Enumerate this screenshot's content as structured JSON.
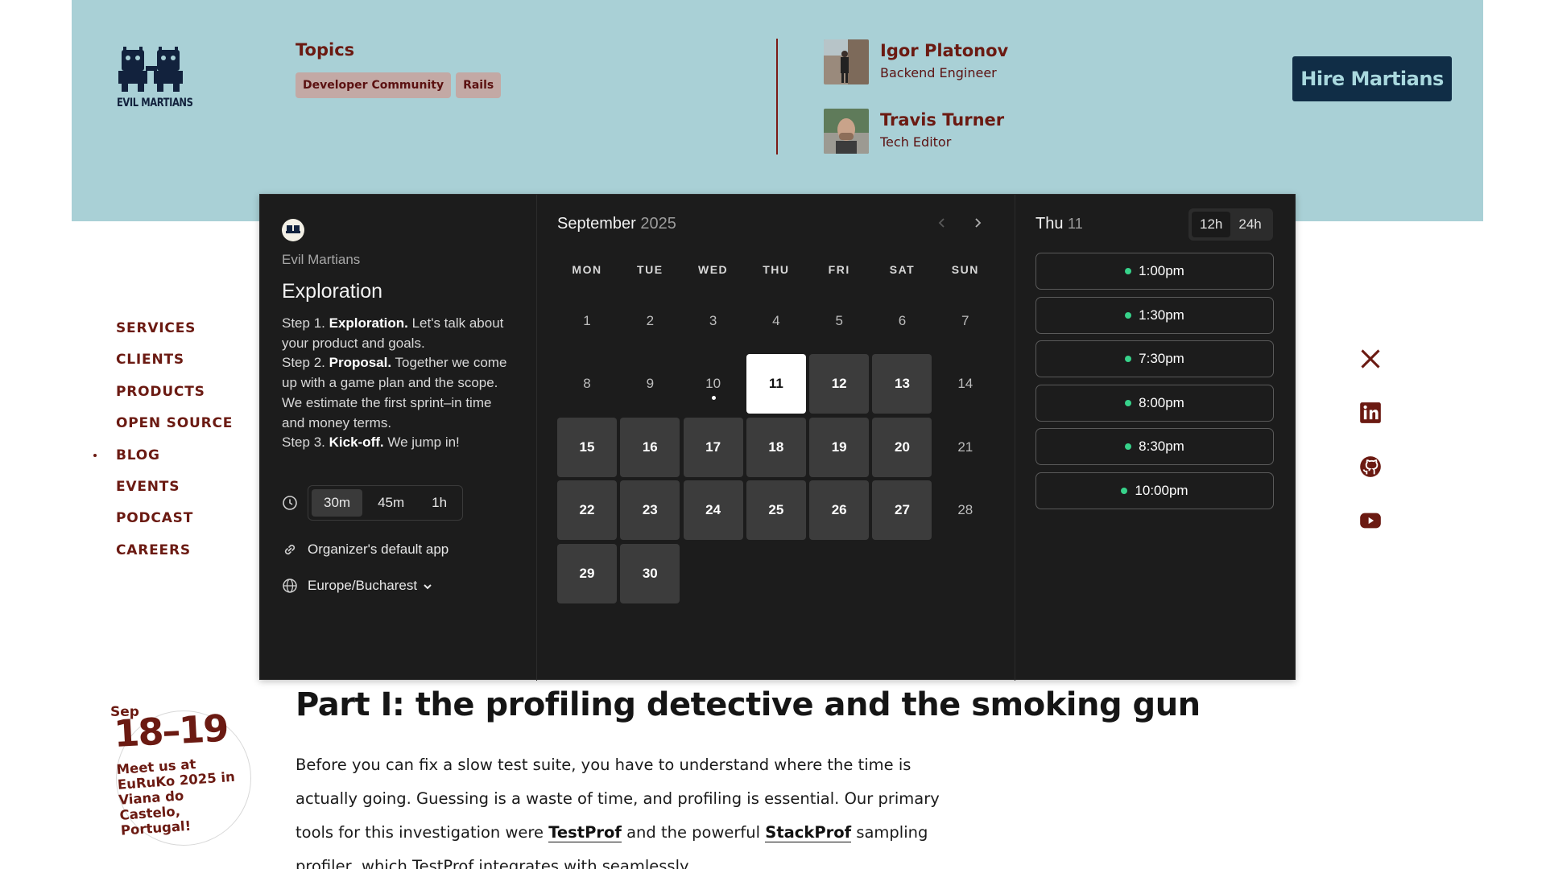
{
  "header": {
    "logo_text": "EVIL MARTIANS",
    "topics_title": "Topics",
    "tags": [
      "Developer Community",
      "Rails"
    ],
    "authors": [
      {
        "name": "Igor Platonov",
        "role": "Backend Engineer"
      },
      {
        "name": "Travis Turner",
        "role": "Tech Editor"
      }
    ],
    "hire_button": "Hire Martians"
  },
  "nav": {
    "items": [
      "SERVICES",
      "CLIENTS",
      "PRODUCTS",
      "OPEN SOURCE",
      "BLOG",
      "EVENTS",
      "PODCAST",
      "CAREERS"
    ],
    "active": "BLOG"
  },
  "socials": [
    "x-icon",
    "linkedin-icon",
    "github-icon",
    "youtube-icon"
  ],
  "booking": {
    "organizer": "Evil Martians",
    "event_title": "Exploration",
    "description": {
      "step1_prefix": "Step 1. ",
      "step1_bold": "Exploration.",
      "step1_text": " Let's talk about your product and goals.",
      "step2_prefix": "Step 2. ",
      "step2_bold": "Proposal.",
      "step2_text": " Together we come up with a game plan and the scope. We estimate the first sprint–in time and money terms.",
      "step3_prefix": "Step 3. ",
      "step3_bold": "Kick-off.",
      "step3_text": " We jump in!"
    },
    "durations": [
      "30m",
      "45m",
      "1h"
    ],
    "selected_duration": "30m",
    "location": "Organizer's default app",
    "timezone": "Europe/Bucharest",
    "calendar": {
      "month": "September",
      "year": "2025",
      "weekdays": [
        "MON",
        "TUE",
        "WED",
        "THU",
        "FRI",
        "SAT",
        "SUN"
      ],
      "days": [
        {
          "d": "1",
          "s": "off"
        },
        {
          "d": "2",
          "s": "off"
        },
        {
          "d": "3",
          "s": "off"
        },
        {
          "d": "4",
          "s": "off"
        },
        {
          "d": "5",
          "s": "off"
        },
        {
          "d": "6",
          "s": "off"
        },
        {
          "d": "7",
          "s": "off"
        },
        {
          "d": "8",
          "s": "off"
        },
        {
          "d": "9",
          "s": "off"
        },
        {
          "d": "10",
          "s": "today"
        },
        {
          "d": "11",
          "s": "selected"
        },
        {
          "d": "12",
          "s": "avail"
        },
        {
          "d": "13",
          "s": "avail"
        },
        {
          "d": "14",
          "s": "off"
        },
        {
          "d": "15",
          "s": "avail"
        },
        {
          "d": "16",
          "s": "avail"
        },
        {
          "d": "17",
          "s": "avail"
        },
        {
          "d": "18",
          "s": "avail"
        },
        {
          "d": "19",
          "s": "avail"
        },
        {
          "d": "20",
          "s": "avail"
        },
        {
          "d": "21",
          "s": "off"
        },
        {
          "d": "22",
          "s": "avail"
        },
        {
          "d": "23",
          "s": "avail"
        },
        {
          "d": "24",
          "s": "avail"
        },
        {
          "d": "25",
          "s": "avail"
        },
        {
          "d": "26",
          "s": "avail"
        },
        {
          "d": "27",
          "s": "avail"
        },
        {
          "d": "28",
          "s": "off"
        },
        {
          "d": "29",
          "s": "avail"
        },
        {
          "d": "30",
          "s": "avail"
        }
      ]
    },
    "selected_day_label": "Thu",
    "selected_day_num": "11",
    "time_formats": [
      "12h",
      "24h"
    ],
    "active_format": "12h",
    "slots": [
      "1:00pm",
      "1:30pm",
      "7:30pm",
      "8:00pm",
      "8:30pm",
      "10:00pm"
    ]
  },
  "article": {
    "title": "Part I: the profiling detective and the smoking gun",
    "p1": "Before you can fix a slow test suite, you have to understand where the time is actually going. Guessing is a waste of time, and profiling is essential. Our primary tools for this investigation were ",
    "link1": "TestProf",
    "p2": " and the powerful ",
    "link2": "StackProf",
    "p3": " sampling profiler, which TestProf integrates with seamlessly."
  },
  "event_badge": {
    "month": "Sep",
    "days": "18–19",
    "text": "Meet us at EuRuKo 2025 in Viana do Castelo, Portugal!"
  },
  "colors": {
    "header_bg": "#a9d0d6",
    "brand_dark": "#6b1a12",
    "dialog_bg": "#1c1c1c",
    "slot_dot": "#37d28a",
    "hire_bg": "#102d46"
  }
}
